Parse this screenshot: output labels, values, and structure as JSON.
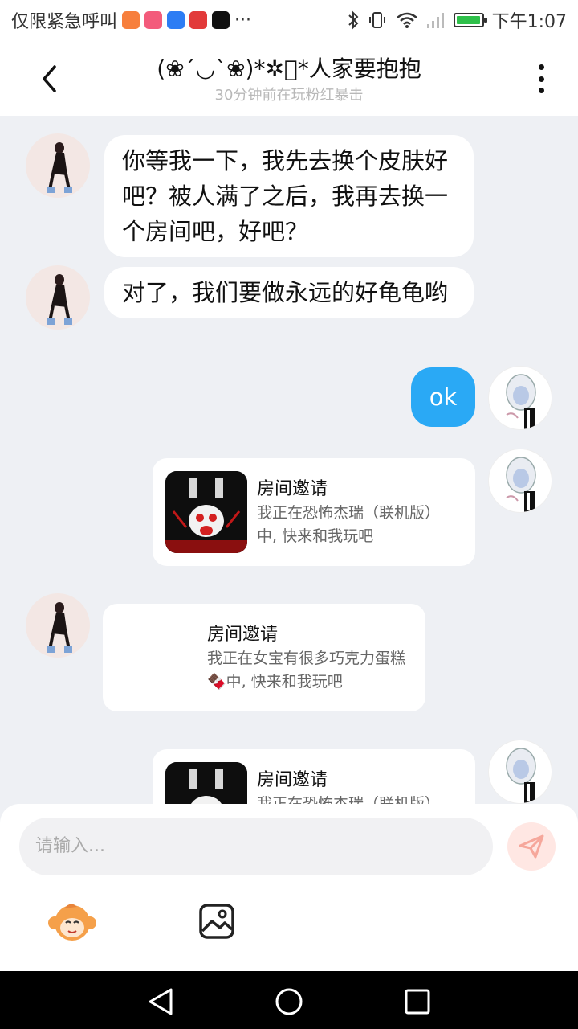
{
  "status_bar": {
    "carrier_text": "仅限紧急呼叫",
    "overflow": "···",
    "time": "下午1:07",
    "battery_level": 0.95
  },
  "header": {
    "title": "(❀´◡`❀)*✲ﾟ*人家要抱抱",
    "subtitle": "30分钟前在玩粉红暴击"
  },
  "messages": [
    {
      "from": "her",
      "type": "text",
      "text": "你等我一下，我先去换个皮肤好吧？被人满了之后，我再去换一个房间吧，好吧？"
    },
    {
      "from": "her",
      "type": "text",
      "text": "对了，我们要做永远的好龟龟哟"
    },
    {
      "from": "me",
      "type": "text",
      "text": "ok"
    },
    {
      "from": "me",
      "type": "invite",
      "title": "房间邀请",
      "desc": "我正在恐怖杰瑞（联机版）中, 快来和我玩吧"
    },
    {
      "from": "her",
      "type": "invite",
      "title": "房间邀请",
      "desc": "我正在女宝有很多巧克力蛋糕🍫中, 快来和我玩吧"
    },
    {
      "from": "me",
      "type": "invite",
      "title": "房间邀请",
      "desc": "我正在恐怖杰瑞（联机版）"
    }
  ],
  "composer": {
    "placeholder": "请输入..."
  },
  "colors": {
    "accent": "#2aa9f5",
    "send_bg": "#ffe7e3",
    "send_icon": "#f6a79b",
    "chat_bg": "#eef0f4"
  }
}
